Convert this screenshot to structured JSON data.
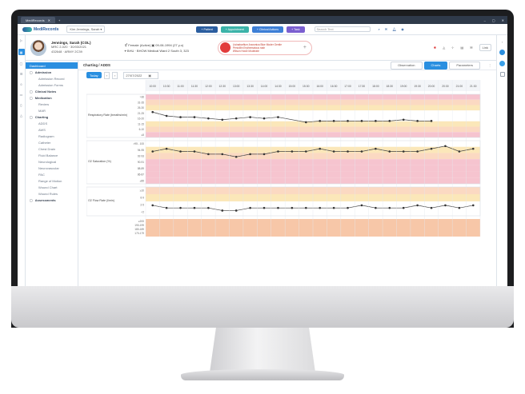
{
  "window": {
    "tab_title": "MediRecords",
    "controls": [
      "–",
      "▢",
      "✕"
    ]
  },
  "appbar": {
    "logo_text": "MediRecords",
    "user_select": "Kim Jennings, Sarah ▾",
    "buttons": [
      {
        "label": "+ Patient",
        "color": "#2a5d9f"
      },
      {
        "label": "+ Appointment",
        "color": "#3bb3a9"
      },
      {
        "label": "+ Clinical Actions",
        "color": "#3d7fd6"
      },
      {
        "label": "+ Task",
        "color": "#7a5fd0"
      }
    ],
    "search_placeholder": "Search Text"
  },
  "patient": {
    "name": "Jennings, Sarah (COL)",
    "mrn": "MRC 2-020 · 30/03/2021",
    "id_line": "432648 · ARMY 2C39",
    "sex_status": "Female (Active)",
    "dob": "09-06-1994 (27 y.o)",
    "location": "BHU · BHOW Medical Ward 2 South 3, 323",
    "alert_line1": "Lisinabarflum Anosmica Blue Moder Gentle",
    "alert_line2": "Penicillin Erythematous rash",
    "alert_line3": "Wilson Howe Moderate",
    "link_label": "Link"
  },
  "sidebar": {
    "items": [
      {
        "label": "Dashboard",
        "type": "active"
      },
      {
        "label": "Admission",
        "type": "group"
      },
      {
        "label": "Admission Record",
        "type": "sub"
      },
      {
        "label": "Admission Forms",
        "type": "sub"
      },
      {
        "label": "Clinical Notes",
        "type": "group"
      },
      {
        "label": "Medication",
        "type": "group"
      },
      {
        "label": "Review",
        "type": "sub"
      },
      {
        "label": "MAR",
        "type": "sub"
      },
      {
        "label": "Charting",
        "type": "group"
      },
      {
        "label": "ADDS",
        "type": "sub"
      },
      {
        "label": "AWS",
        "type": "sub"
      },
      {
        "label": "Radiogram",
        "type": "sub"
      },
      {
        "label": "Catheter",
        "type": "sub"
      },
      {
        "label": "Chest Drain",
        "type": "sub"
      },
      {
        "label": "Fluid Balance",
        "type": "sub"
      },
      {
        "label": "Neurological",
        "type": "sub"
      },
      {
        "label": "Neurovascular",
        "type": "sub"
      },
      {
        "label": "PAC",
        "type": "sub"
      },
      {
        "label": "Range of Motion",
        "type": "sub"
      },
      {
        "label": "Wound Chart",
        "type": "sub"
      },
      {
        "label": "Wound Rules",
        "type": "sub"
      },
      {
        "label": "Assessments",
        "type": "group"
      }
    ]
  },
  "panel": {
    "title": "Charting / ADDS",
    "views": [
      "Observation",
      "Charts",
      "Parameters"
    ],
    "active_view": "Charts",
    "today_label": "Today",
    "date_value": "27/07/2022"
  },
  "chart_data": {
    "type": "line",
    "x": [
      "10:00",
      "10:30",
      "11:00",
      "11:30",
      "12:00",
      "12:30",
      "13:00",
      "13:30",
      "14:00",
      "14:30",
      "15:00",
      "15:30",
      "16:00",
      "16:30",
      "17:00",
      "17:30",
      "18:00",
      "18:30",
      "19:00",
      "19:30",
      "20:00",
      "20:30",
      "21:00",
      "21:30"
    ],
    "rows": [
      {
        "label": "Respiratory Rate (breaths/min)",
        "ticks": [
          ">36",
          "31-35",
          "26-30",
          "21-25",
          "16-20",
          "11-15",
          "6-10",
          "≤5"
        ],
        "values": [
          24,
          21,
          20,
          20,
          19,
          18,
          19,
          20,
          19,
          20,
          null,
          16,
          17,
          17,
          17,
          17,
          17,
          17,
          18,
          17,
          17,
          null,
          null,
          null
        ]
      },
      {
        "label": "O2 Saturation (%)",
        "ticks": [
          ">95 - 100",
          "94-95",
          "92-93",
          "90-91",
          "88-89",
          "86-87",
          "≤85"
        ],
        "values": [
          96,
          97,
          96,
          96,
          95,
          95,
          94,
          95,
          95,
          96,
          96,
          96,
          97,
          96,
          96,
          96,
          97,
          96,
          96,
          96,
          97,
          98,
          96,
          97
        ]
      },
      {
        "label": "O2 Flow Rate (l/min)",
        "ticks": [
          "≥10",
          "6-9",
          "2-5",
          "<2"
        ],
        "values": [
          4,
          3,
          3,
          3,
          3,
          2,
          2,
          3,
          3,
          3,
          3,
          3,
          3,
          3,
          3,
          4,
          3,
          3,
          3,
          4,
          3,
          4,
          3,
          4
        ]
      }
    ],
    "bottom_row_ticks": [
      "≥200",
      "190-199",
      "180-189",
      "170-179"
    ]
  }
}
